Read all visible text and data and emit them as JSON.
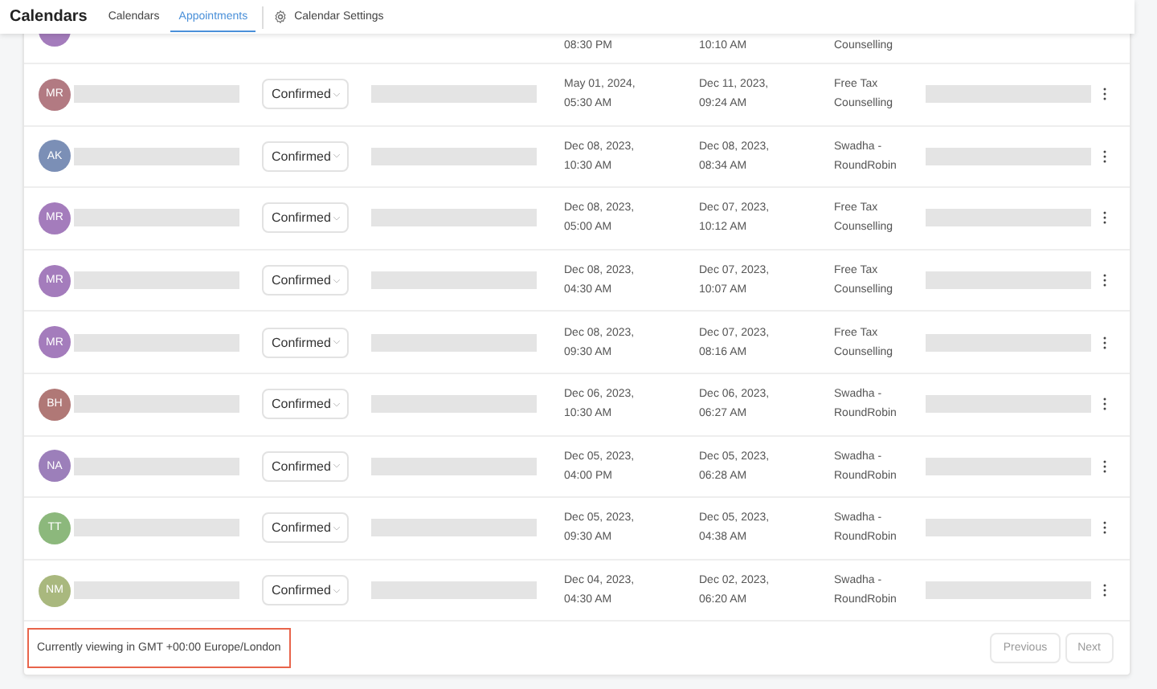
{
  "header": {
    "title": "Calendars",
    "tabs": [
      {
        "label": "Calendars",
        "selected": false
      },
      {
        "label": "Appointments",
        "selected": true
      }
    ],
    "settings_link": "Calendar Settings"
  },
  "partial_row": {
    "start_time": "08:30 PM",
    "end_time": "10:10 AM",
    "calendar": "Counselling",
    "color": "#a47cbc"
  },
  "rows": [
    {
      "initials": "MR",
      "color": "#b27a82",
      "status": "Confirmed",
      "start": [
        "May 01, 2024,",
        "05:30 AM"
      ],
      "end": [
        "Dec 11, 2023,",
        "09:24 AM"
      ],
      "calendar": [
        "Free Tax",
        "Counselling"
      ]
    },
    {
      "initials": "AK",
      "color": "#7b8fb6",
      "status": "Confirmed",
      "start": [
        "Dec 08, 2023,",
        "10:30 AM"
      ],
      "end": [
        "Dec 08, 2023,",
        "08:34 AM"
      ],
      "calendar": [
        "Swadha -",
        "RoundRobin"
      ]
    },
    {
      "initials": "MR",
      "color": "#a47cbc",
      "status": "Confirmed",
      "start": [
        "Dec 08, 2023,",
        "05:00 AM"
      ],
      "end": [
        "Dec 07, 2023,",
        "10:12 AM"
      ],
      "calendar": [
        "Free Tax",
        "Counselling"
      ]
    },
    {
      "initials": "MR",
      "color": "#a47cbc",
      "status": "Confirmed",
      "start": [
        "Dec 08, 2023,",
        "04:30 AM"
      ],
      "end": [
        "Dec 07, 2023,",
        "10:07 AM"
      ],
      "calendar": [
        "Free Tax",
        "Counselling"
      ]
    },
    {
      "initials": "MR",
      "color": "#a47cbc",
      "status": "Confirmed",
      "start": [
        "Dec 08, 2023,",
        "09:30 AM"
      ],
      "end": [
        "Dec 07, 2023,",
        "08:16 AM"
      ],
      "calendar": [
        "Free Tax",
        "Counselling"
      ]
    },
    {
      "initials": "BH",
      "color": "#b07876",
      "status": "Confirmed",
      "start": [
        "Dec 06, 2023,",
        "10:30 AM"
      ],
      "end": [
        "Dec 06, 2023,",
        "06:27 AM"
      ],
      "calendar": [
        "Swadha -",
        "RoundRobin"
      ]
    },
    {
      "initials": "NA",
      "color": "#9c7fba",
      "status": "Confirmed",
      "start": [
        "Dec 05, 2023,",
        "04:00 PM"
      ],
      "end": [
        "Dec 05, 2023,",
        "06:28 AM"
      ],
      "calendar": [
        "Swadha -",
        "RoundRobin"
      ]
    },
    {
      "initials": "TT",
      "color": "#8cb87c",
      "status": "Confirmed",
      "start": [
        "Dec 05, 2023,",
        "09:30 AM"
      ],
      "end": [
        "Dec 05, 2023,",
        "04:38 AM"
      ],
      "calendar": [
        "Swadha -",
        "RoundRobin"
      ]
    },
    {
      "initials": "NM",
      "color": "#a9b87e",
      "status": "Confirmed",
      "start": [
        "Dec 04, 2023,",
        "04:30 AM"
      ],
      "end": [
        "Dec 02, 2023,",
        "06:20 AM"
      ],
      "calendar": [
        "Swadha -",
        "RoundRobin"
      ]
    }
  ],
  "footer": {
    "timezone": "Currently viewing in GMT +00:00 Europe/London",
    "buttons": [
      "Previous",
      "Next"
    ]
  }
}
